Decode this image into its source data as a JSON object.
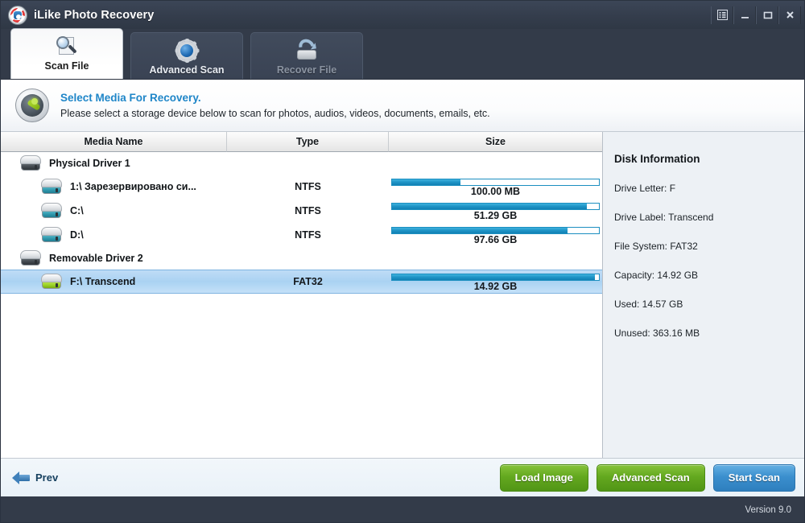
{
  "window": {
    "title": "iLike Photo Recovery",
    "logo_icon": "app-logo-icon",
    "buttons": {
      "menu": "menu-icon",
      "minimize": "minimize-icon",
      "maximize": "maximize-icon",
      "close": "close-icon"
    }
  },
  "tabs": [
    {
      "label": "Scan File",
      "icon": "magnifier-scan-icon",
      "state": "active"
    },
    {
      "label": "Advanced Scan",
      "icon": "gear-icon",
      "state": "inactive"
    },
    {
      "label": "Recover File",
      "icon": "recover-drive-icon",
      "state": "disabled"
    }
  ],
  "banner": {
    "icon": "media-compass-icon",
    "title": "Select Media For Recovery.",
    "subtitle": "Please select a storage device below to scan for photos, audios, videos, documents, emails, etc."
  },
  "table": {
    "columns": [
      "Media Name",
      "Type",
      "Size"
    ],
    "rows": [
      {
        "kind": "group",
        "indent": 0,
        "icon": "drive-icon-dark",
        "name": "Physical Driver 1",
        "type": "",
        "size_label": "",
        "fill_pct": 0
      },
      {
        "kind": "volume",
        "indent": 1,
        "icon": "drive-icon-teal",
        "name": "1:\\ Зарезервировано си...",
        "type": "NTFS",
        "size_label": "100.00 MB",
        "fill_pct": 33
      },
      {
        "kind": "volume",
        "indent": 1,
        "icon": "drive-icon-teal",
        "name": "C:\\",
        "type": "NTFS",
        "size_label": "51.29 GB",
        "fill_pct": 94
      },
      {
        "kind": "volume",
        "indent": 1,
        "icon": "drive-icon-teal",
        "name": "D:\\",
        "type": "NTFS",
        "size_label": "97.66 GB",
        "fill_pct": 85
      },
      {
        "kind": "group",
        "indent": 0,
        "icon": "drive-icon-dark",
        "name": "Removable Driver 2",
        "type": "",
        "size_label": "",
        "fill_pct": 0
      },
      {
        "kind": "volume",
        "indent": 1,
        "icon": "drive-icon-green",
        "name": "F:\\ Transcend",
        "type": "FAT32",
        "size_label": "14.92 GB",
        "fill_pct": 98,
        "selected": true
      }
    ]
  },
  "disk_info": {
    "title": "Disk Information",
    "lines": [
      "Drive Letter: F",
      "Drive Label: Transcend",
      "File System: FAT32",
      "Capacity: 14.92 GB",
      "Used: 14.57 GB",
      "Unused: 363.16 MB"
    ]
  },
  "footer": {
    "prev_label": "Prev",
    "prev_icon": "arrow-left-icon",
    "buttons": [
      {
        "label": "Load Image",
        "style": "green"
      },
      {
        "label": "Advanced Scan",
        "style": "green"
      },
      {
        "label": "Start Scan",
        "style": "blue"
      }
    ]
  },
  "status": {
    "version": "Version 9.0"
  },
  "colors": {
    "chrome": "#333b49",
    "accent_blue": "#1f86c8",
    "button_green": "#63a81f",
    "button_blue": "#3b8fce",
    "selection": "#aad2f2",
    "bar_fill": "#1e93c6"
  }
}
